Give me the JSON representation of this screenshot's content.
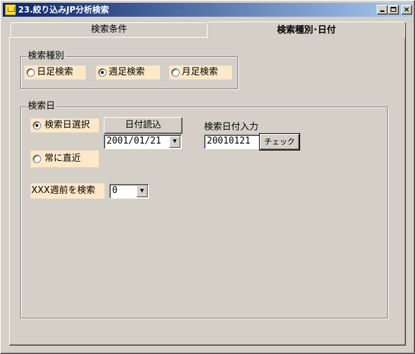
{
  "window": {
    "title": "23.絞り込みJP分析検索",
    "minimize_label": "_",
    "maximize_label": "□",
    "close_label": "×"
  },
  "tabs": [
    {
      "label": "検索条件",
      "active": false
    },
    {
      "label": "検索種別･日付",
      "active": true
    }
  ],
  "search_type": {
    "legend": "検索種別",
    "options": [
      {
        "label": "日足検索",
        "checked": false
      },
      {
        "label": "週足検索",
        "checked": true
      },
      {
        "label": "月足検索",
        "checked": false
      }
    ]
  },
  "search_date": {
    "legend": "検索日",
    "select_date_label": "検索日選択",
    "select_date_checked": true,
    "read_date_button": "日付読込",
    "date_combo_value": "2001/01/21",
    "date_input_label": "検索日付入力",
    "date_input_value": "20010121",
    "check_button": "チェック",
    "always_latest_label": "常に直近",
    "always_latest_checked": false,
    "weeks_before_label": "XXX週前を検索",
    "weeks_before_value": "0"
  },
  "colors": {
    "title_bar_start": "#0a246a",
    "title_bar_end": "#a6caf0",
    "option_highlight": "#fde8c8",
    "face": "#d4d0c8"
  }
}
